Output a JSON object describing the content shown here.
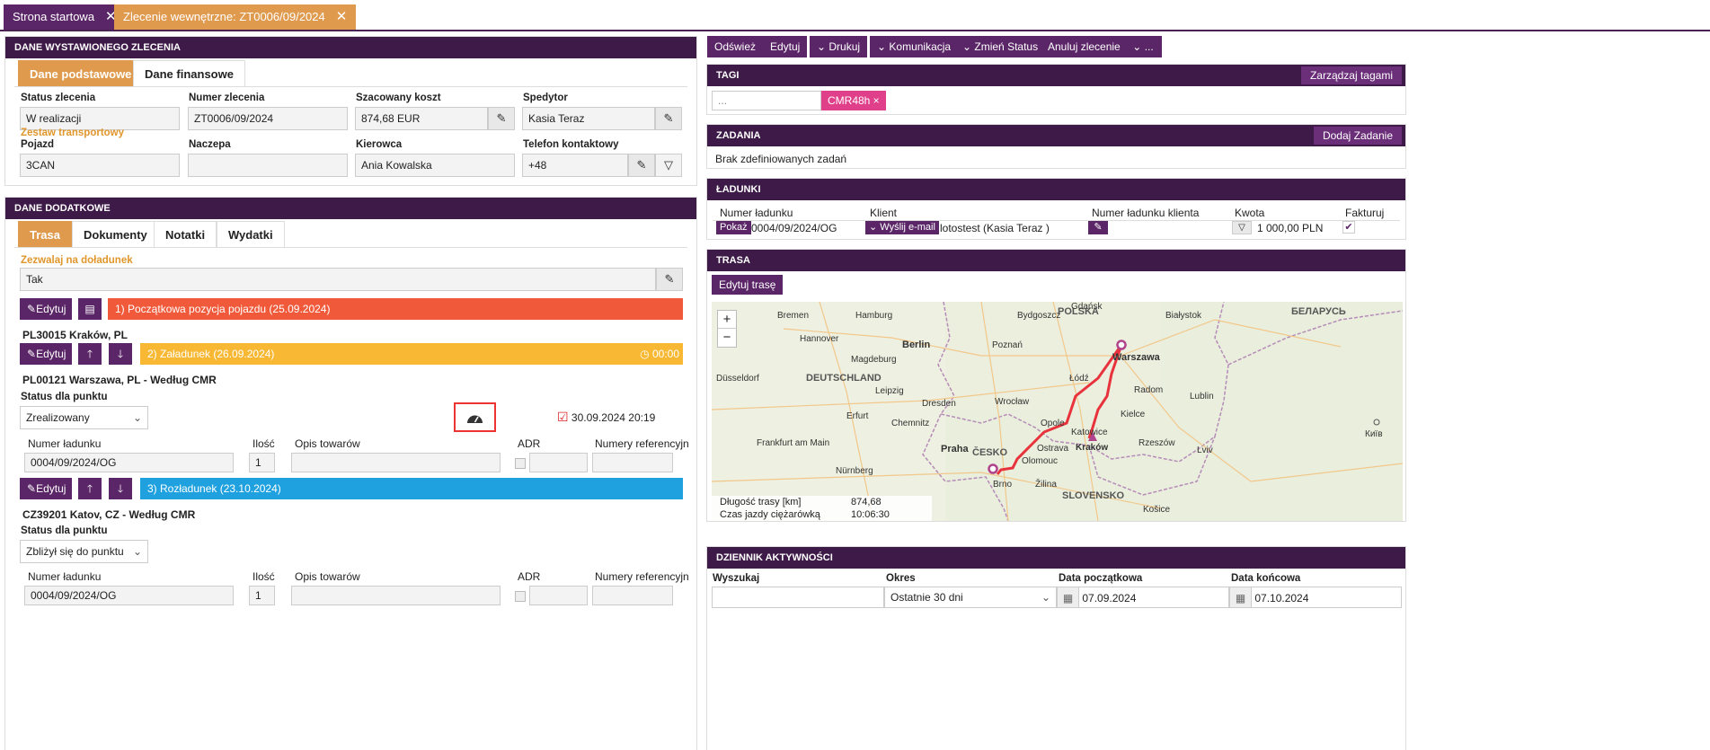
{
  "topbar": {
    "tabs": [
      {
        "label": "Strona startowa",
        "close": "✕"
      },
      {
        "label": "Zlecenie wewnętrzne: ZT0006/09/2024",
        "close": "✕"
      }
    ]
  },
  "order": {
    "header": "DANE WYSTAWIONEGO ZLECENIA",
    "tabs": [
      "Dane podstawowe",
      "Dane finansowe"
    ],
    "status_label": "Status zlecenia",
    "status_value": "W realizacji",
    "number_label": "Numer zlecenia",
    "number_value": "ZT0006/09/2024",
    "cost_label": "Szacowany koszt",
    "cost_value": "874,68 EUR",
    "forwarder_label": "Spedytor",
    "forwarder_value": "Kasia Teraz",
    "set_label": "Zestaw transportowy",
    "vehicle_label": "Pojazd",
    "vehicle_value": "3CAN",
    "trailer_label": "Naczepa",
    "trailer_value": "",
    "driver_label": "Kierowca",
    "driver_value": "Ania Kowalska",
    "phone_label": "Telefon kontaktowy",
    "phone_value": "+48"
  },
  "extra": {
    "header": "DANE DODATKOWE",
    "tabs": [
      "Trasa",
      "Dokumenty",
      "Notatki",
      "Wydatki"
    ],
    "reload_label": "Zezwalaj na doładunek",
    "reload_value": "Tak",
    "edit_label": "Edytuj",
    "points": [
      {
        "bar": "1) Początkowa pozycja pojazdu (25.09.2024)",
        "addr": "PL30015 Kraków, PL"
      },
      {
        "bar": "2) Załadunek (26.09.2024)",
        "time": "00:00",
        "addr": "PL00121 Warszawa, PL - Według CMR",
        "status_label": "Status dla punktu",
        "status": "Zrealizowany",
        "done": "30.09.2024 20:19"
      },
      {
        "bar": "3) Rozładunek (23.10.2024)",
        "addr": "CZ39201 Katov, CZ - Według CMR",
        "status_label": "Status dla punktu",
        "status": "Zbliżył się do punktu"
      }
    ],
    "cols": [
      "Numer ładunku",
      "Ilość",
      "Opis towarów",
      "ADR",
      "Numery referencyjn"
    ],
    "row1": {
      "num": "0004/09/2024/OG",
      "qty": "1"
    },
    "row2": {
      "num": "0004/09/2024/OG",
      "qty": "1"
    }
  },
  "toolbar": {
    "refresh": "Odśwież",
    "edit": "Edytuj",
    "print": "Drukuj",
    "comm": "Komunikacja",
    "status": "Zmień Status",
    "cancel": "Anuluj zlecenie",
    "more": "..."
  },
  "tags": {
    "header": "TAGI",
    "manage": "Zarządzaj tagami",
    "placeholder": "...",
    "tag": "CMR48h ×"
  },
  "tasks": {
    "header": "ZADANIA",
    "add": "Dodaj Zadanie",
    "empty": "Brak zdefiniowanych zadań"
  },
  "loads": {
    "header": "ŁADUNKI",
    "cols": [
      "Numer ładunku",
      "Klient",
      "Numer ładunku klienta",
      "Kwota",
      "Fakturuj"
    ],
    "show": "Pokaż",
    "num": "0004/09/2024/OG",
    "email": "Wyślij e-mail",
    "client": "lotostest (Kasia Teraz )",
    "amount": "1 000,00 PLN"
  },
  "route": {
    "header": "TRASA",
    "edit": "Edytuj trasę",
    "zoom_in": "+",
    "zoom_out": "−",
    "len_label": "Długość trasy [km]",
    "len_value": "874,68",
    "time_label": "Czas jazdy ciężarówką",
    "time_value": "10:06:30",
    "map_labels": [
      "POLSKA",
      "БЕЛАРУСЬ",
      "Warszawa",
      "Berlin",
      "DEUTSCHLAND",
      "Praha",
      "ČESKO",
      "SLOVENSKO",
      "Kraków",
      "Brno",
      "Poznań",
      "Łódź",
      "Wrocław",
      "Hamburg",
      "Bremen",
      "Hannover",
      "Leipzig",
      "Dresden",
      "Nürnberg",
      "Frankfurt am Main",
      "Düsseldorf",
      "Київ",
      "Lublin",
      "Radom",
      "Kielce",
      "Opole",
      "Katowice",
      "Bydgoszcz",
      "Gdańsk",
      "Białystok",
      "Magdeburg",
      "Erfurt",
      "Chemnitz",
      "Olomouc",
      "Ostrava",
      "Žilina",
      "Košice",
      "Rzeszów",
      "Lviv"
    ]
  },
  "activity": {
    "header": "DZIENNIK AKTYWNOŚCI",
    "search_label": "Wyszukaj",
    "period_label": "Okres",
    "period": "Ostatnie 30 dni",
    "from_label": "Data początkowa",
    "from": "07.09.2024",
    "to_label": "Data końcowa",
    "to": "07.10.2024"
  }
}
